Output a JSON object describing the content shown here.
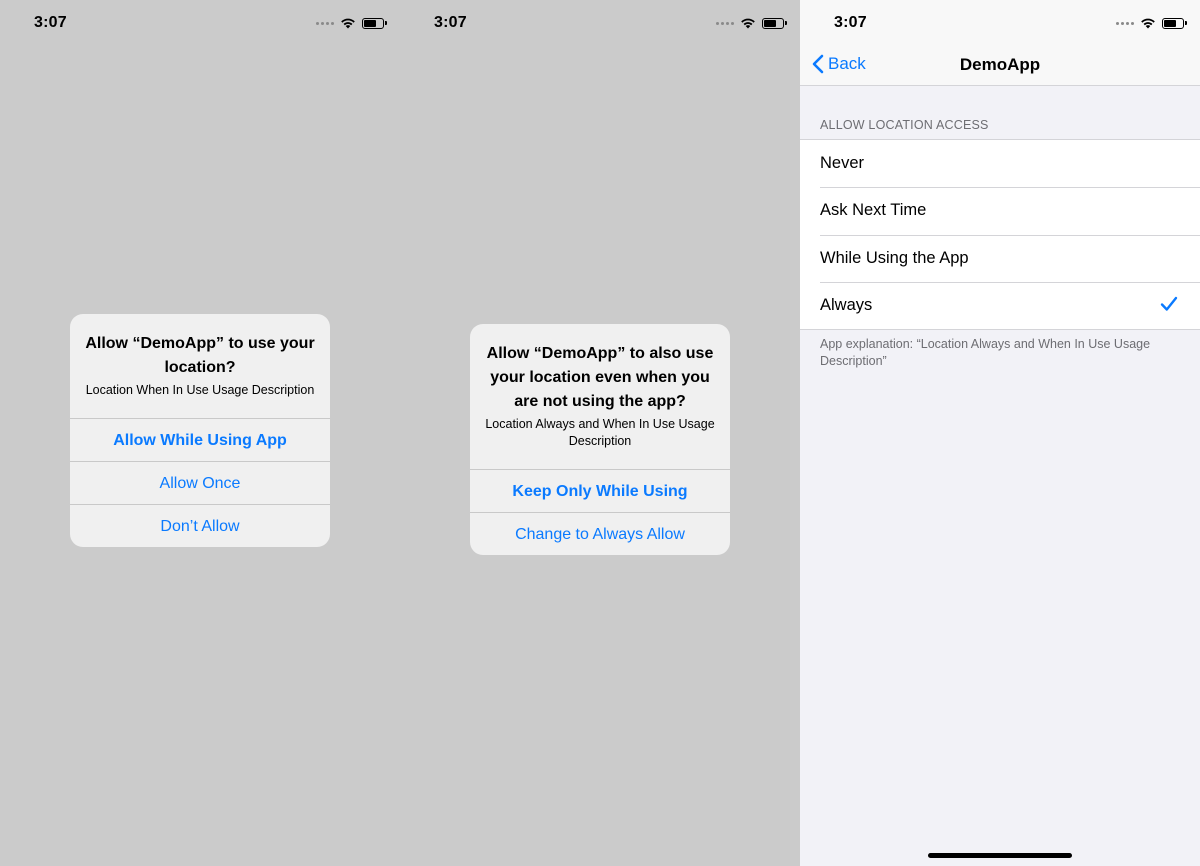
{
  "status_bar": {
    "time": "3:07",
    "battery_level": 0.6
  },
  "screen1": {
    "alert": {
      "title": "Allow “DemoApp” to use your location?",
      "message": "Location When In Use Usage Description",
      "buttons": [
        "Allow While Using App",
        "Allow Once",
        "Don’t Allow"
      ]
    }
  },
  "screen2": {
    "alert": {
      "title": "Allow “DemoApp” to also use your location even when you are not using the app?",
      "message": "Location Always and When In Use Usage Description",
      "buttons": [
        "Keep Only While Using",
        "Change to Always Allow"
      ]
    }
  },
  "screen3": {
    "nav": {
      "back_label": "Back",
      "title": "DemoApp"
    },
    "section_header": "ALLOW LOCATION ACCESS",
    "options": [
      "Never",
      "Ask Next Time",
      "While Using the App",
      "Always"
    ],
    "selected_option": "Always",
    "footer": "App explanation: “Location Always and When In Use Usage Description”"
  },
  "colors": {
    "accent": "#0a7aff",
    "dim_background": "#cbcbcb",
    "settings_background": "#f2f2f7"
  },
  "icons": [
    "signal-icon",
    "wifi-icon",
    "battery-icon",
    "chevron-left-icon",
    "checkmark-icon"
  ]
}
